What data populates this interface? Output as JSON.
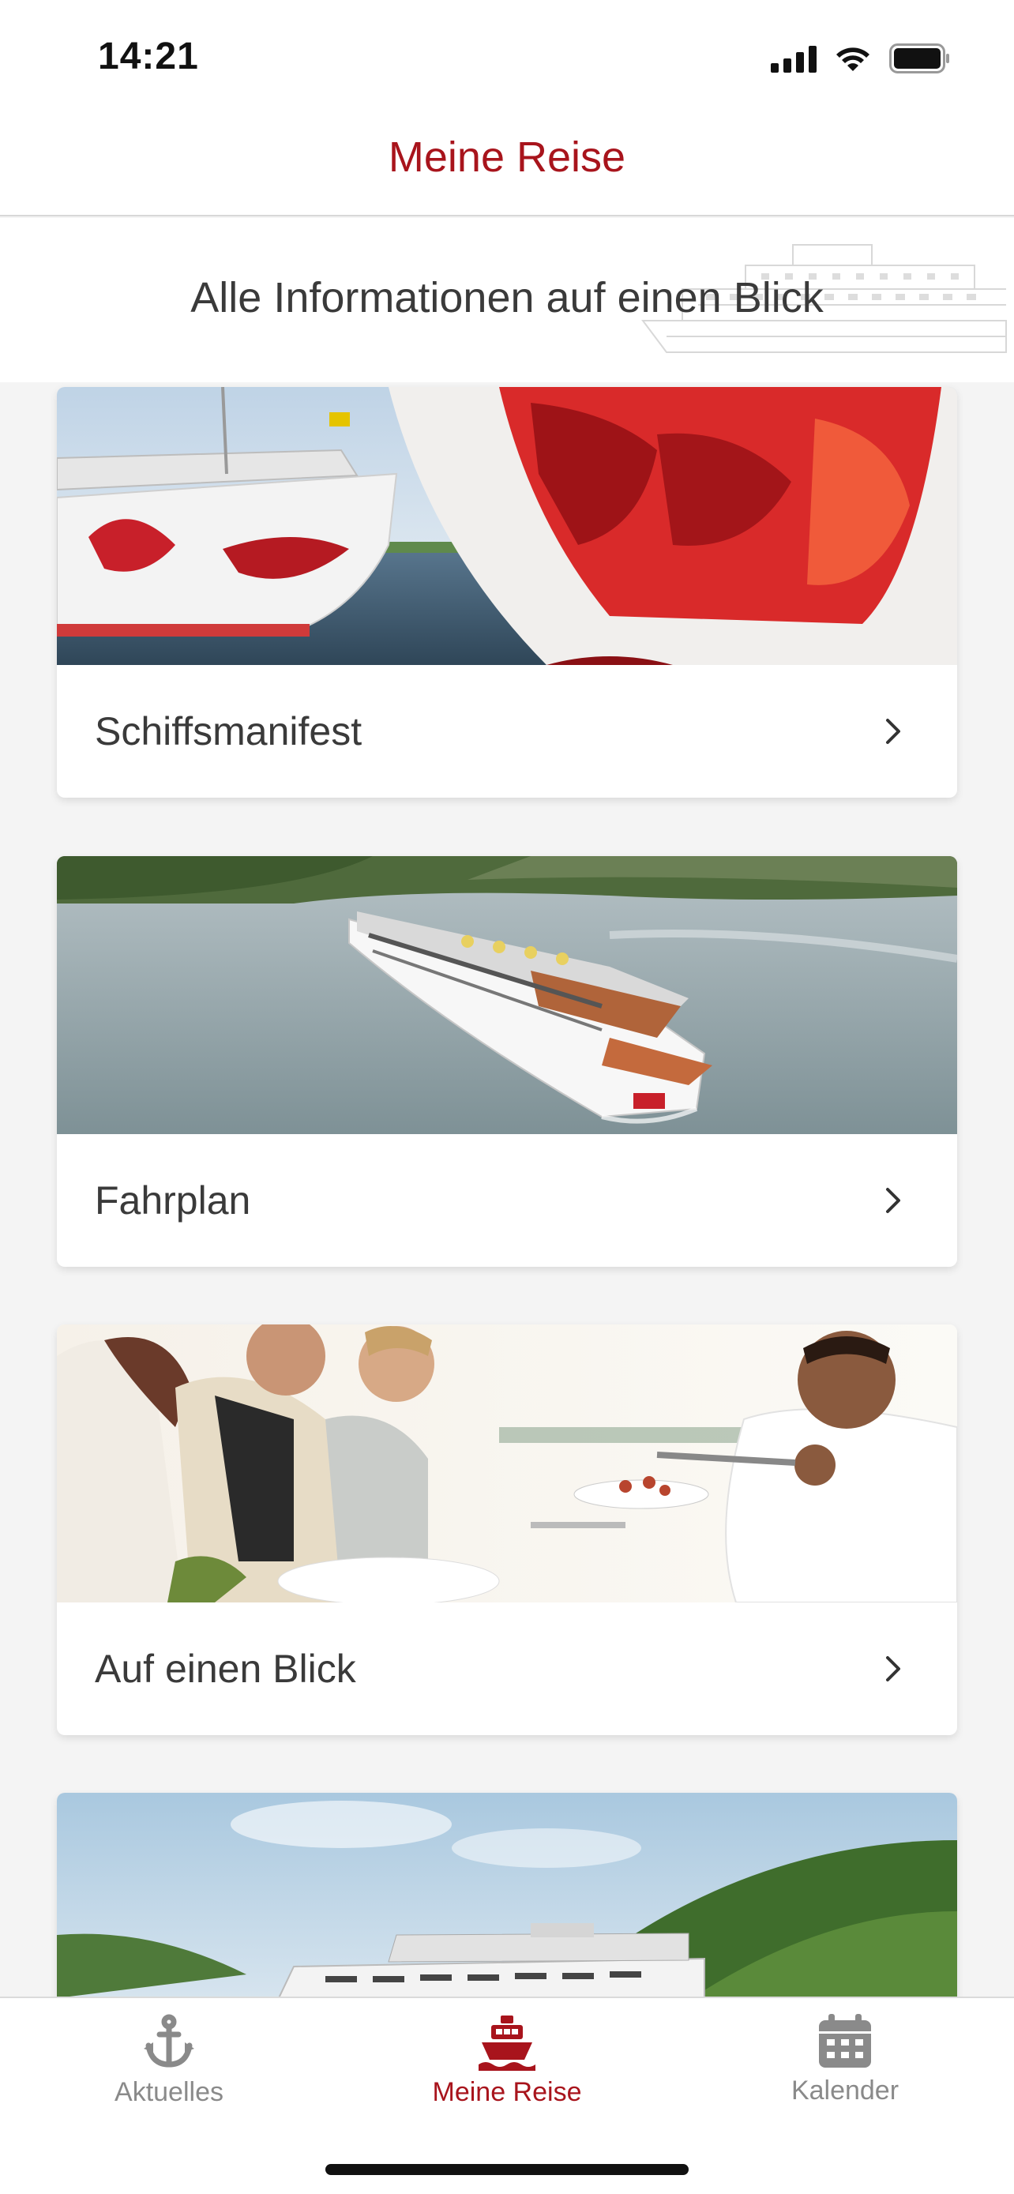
{
  "status_bar": {
    "time": "14:21"
  },
  "header": {
    "title": "Meine Reise"
  },
  "hero": {
    "text": "Alle Informationen auf einen Blick"
  },
  "cards": [
    {
      "label": "Schiffsmanifest"
    },
    {
      "label": "Fahrplan"
    },
    {
      "label": "Auf einen Blick"
    },
    {
      "label": ""
    }
  ],
  "tabs": [
    {
      "label": "Aktuelles",
      "icon": "anchor-icon"
    },
    {
      "label": "Meine Reise",
      "icon": "ship-icon",
      "active": true
    },
    {
      "label": "Kalender",
      "icon": "calendar-icon"
    }
  ],
  "colors": {
    "accent": "#a8141c",
    "inactive": "#8a8a8a"
  }
}
